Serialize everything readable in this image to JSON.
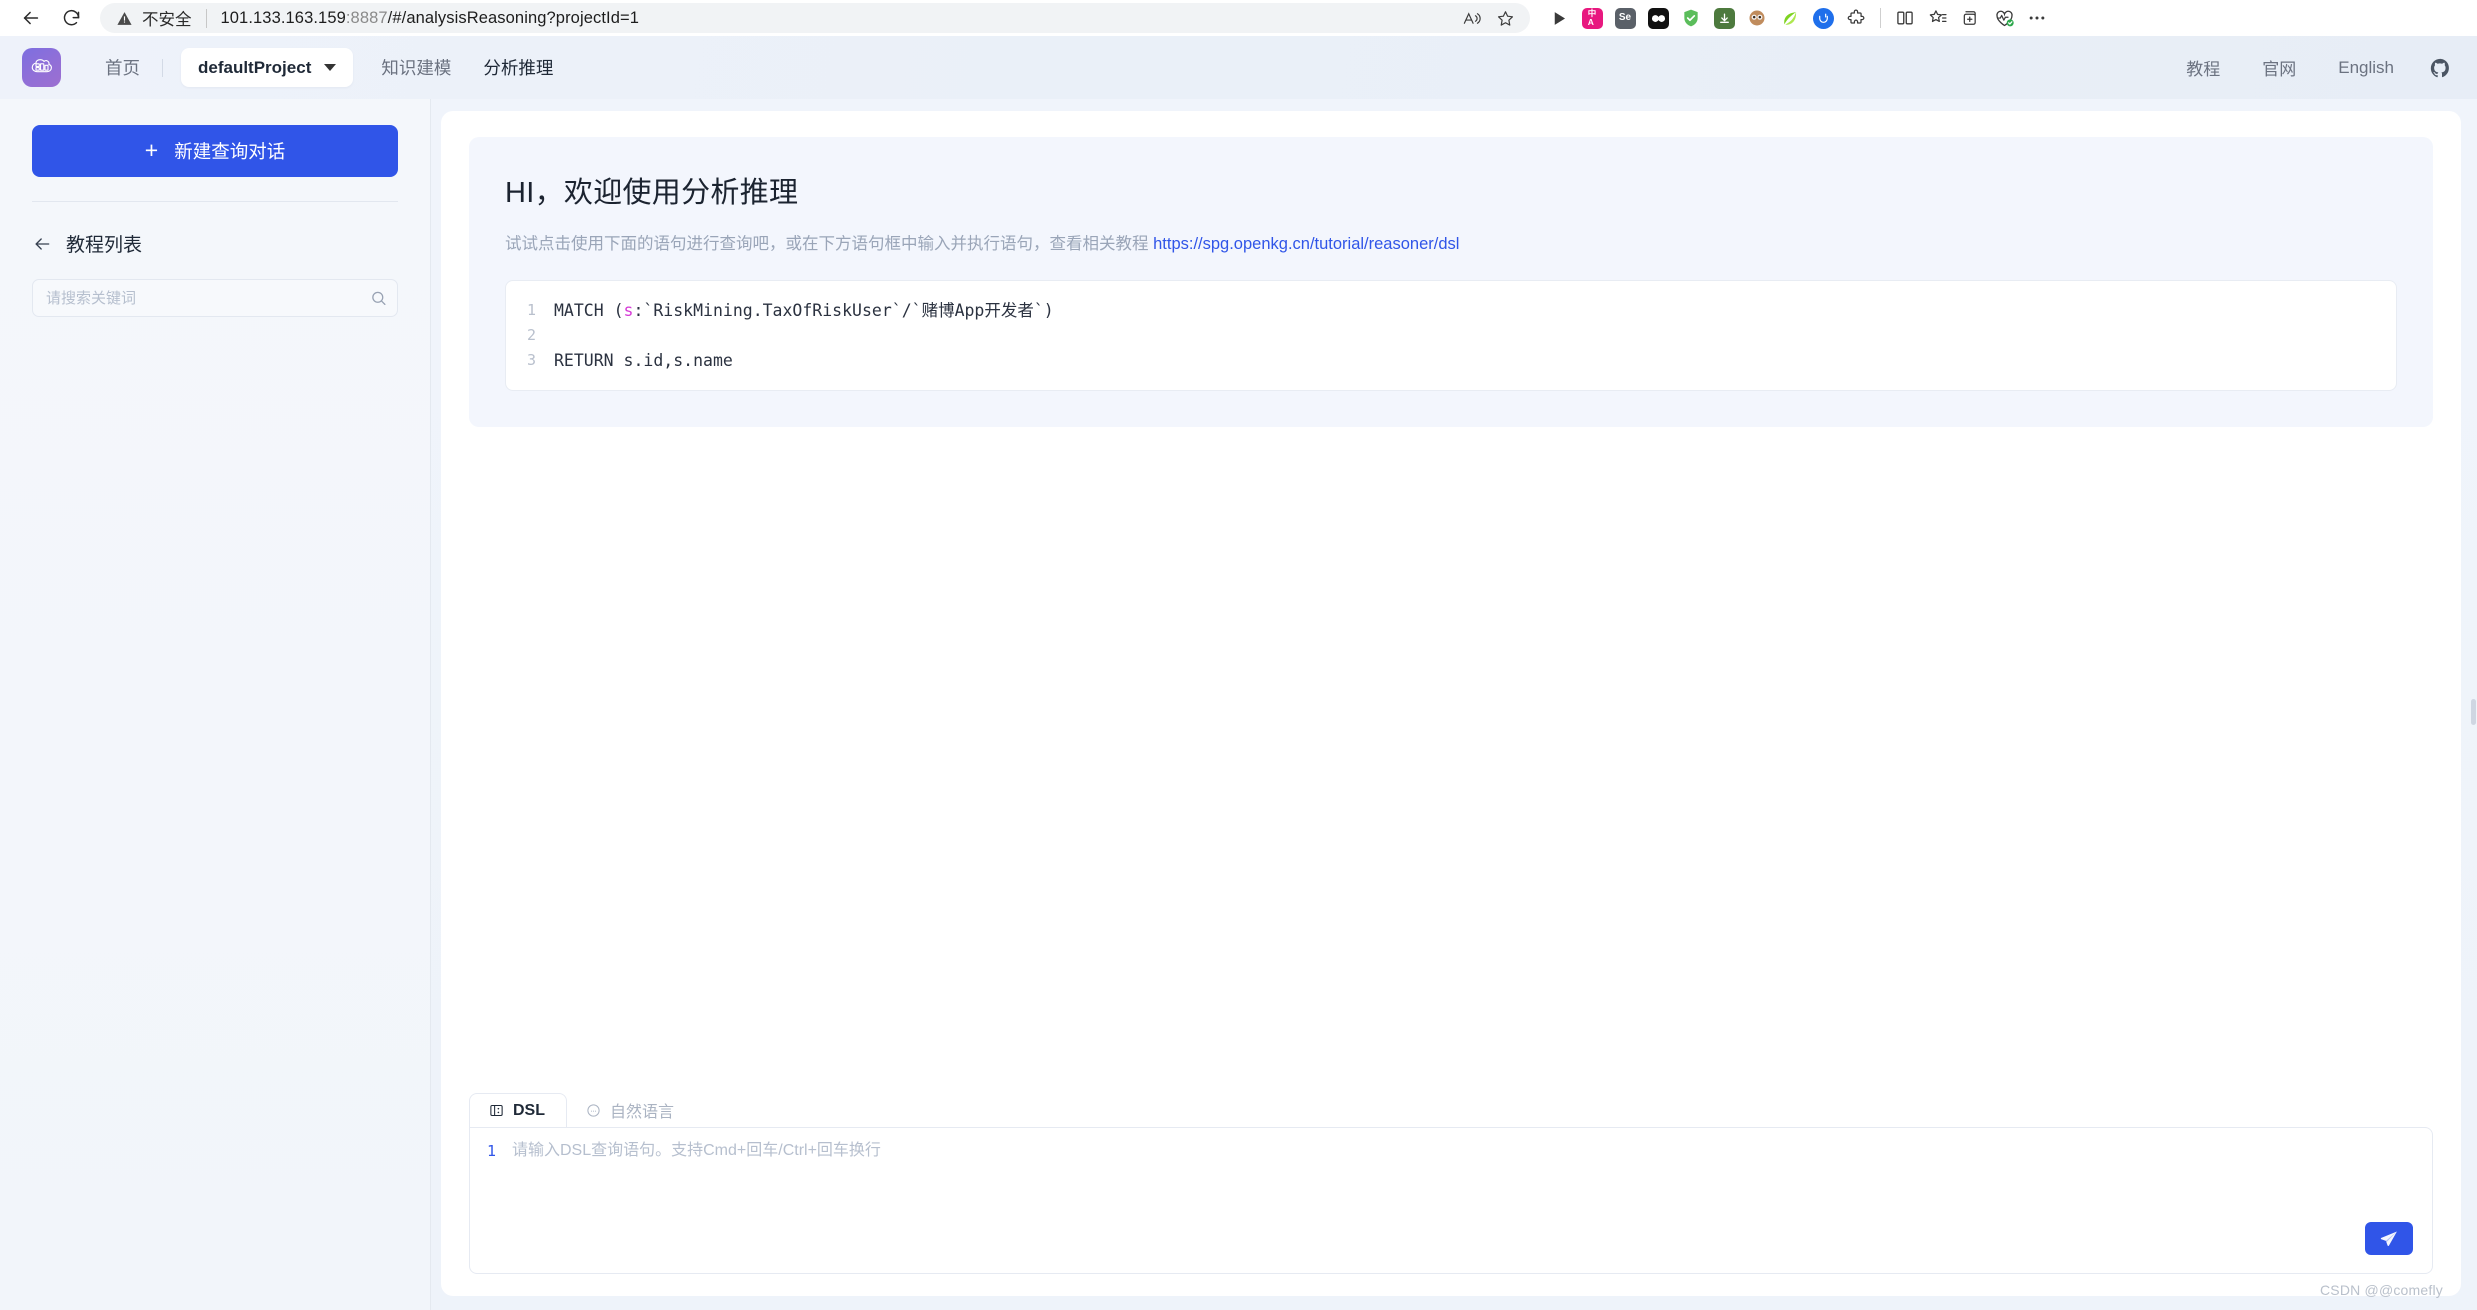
{
  "browser": {
    "back_label": "back-arrow",
    "reload_label": "reload",
    "security_text": "不安全",
    "url_main": "101.133.163.159",
    "url_port": ":8887",
    "url_path": "/#/analysisReasoning?projectId=1",
    "extensions": [
      {
        "name": "read-aloud-icon",
        "label": ""
      },
      {
        "name": "favorite-star-icon",
        "label": ""
      },
      {
        "name": "play-button-icon",
        "label": ""
      },
      {
        "name": "translate-extension-icon",
        "label": "中A"
      },
      {
        "name": "selenium-recorder-icon",
        "label": "Se"
      },
      {
        "name": "dark-rounded-extension-icon",
        "label": ""
      },
      {
        "name": "adguard-shield-icon",
        "label": ""
      },
      {
        "name": "download-manager-icon",
        "label": ""
      },
      {
        "name": "profile-avatar-icon",
        "label": ""
      },
      {
        "name": "leaf-extension-icon",
        "label": ""
      },
      {
        "name": "blue-smiley-extension-icon",
        "label": ""
      },
      {
        "name": "puzzle-extensions-icon",
        "label": ""
      },
      {
        "name": "split-screen-icon",
        "label": ""
      },
      {
        "name": "favorites-list-icon",
        "label": ""
      },
      {
        "name": "add-to-collection-icon",
        "label": ""
      },
      {
        "name": "performance-heart-icon",
        "label": ""
      },
      {
        "name": "more-options-icon",
        "label": ""
      }
    ]
  },
  "header": {
    "logo_name": "openspg-logo",
    "home_label": "首页",
    "project_name": "defaultProject",
    "nav_modeling": "知识建模",
    "nav_reasoning": "分析推理",
    "tutorial_label": "教程",
    "official_site_label": "官网",
    "language_label": "English",
    "github_label": "github-icon"
  },
  "sidebar": {
    "new_chat_label": "新建查询对话",
    "new_chat_plus": "+",
    "tutorial_list_label": "教程列表",
    "search_placeholder": "请搜索关键词",
    "search_value": ""
  },
  "welcome": {
    "title": "HI，欢迎使用分析推理",
    "subtitle_before": "试试点击使用下面的语句进行查询吧，或在下方语句框中输入并执行语句，查看相关教程 ",
    "link_text": "https://spg.openkg.cn/tutorial/reasoner/dsl"
  },
  "code_sample": {
    "lines": [
      {
        "no": "1",
        "prefix": "MATCH (",
        "var": "s",
        "suffix": ":`RiskMining.TaxOfRiskUser`/`赌博App开发者`)"
      },
      {
        "no": "2",
        "prefix": "",
        "var": "",
        "suffix": ""
      },
      {
        "no": "3",
        "prefix": "RETURN s.id,s.name",
        "var": "",
        "suffix": ""
      }
    ]
  },
  "input_panel": {
    "tab_dsl": "DSL",
    "tab_natural_language": "自然语言",
    "editor_line_no": "1",
    "editor_placeholder": "请输入DSL查询语句。支持Cmd+回车/Ctrl+回车换行",
    "editor_value": "",
    "send_label": "send-icon"
  },
  "watermark": "CSDN @@comefly",
  "colors": {
    "primary_blue": "#3055e8",
    "link_blue": "#3055e8",
    "card_bg": "#f3f6fd",
    "sidebar_bg": "#f3f6fb",
    "code_var": "#d63bd6"
  }
}
